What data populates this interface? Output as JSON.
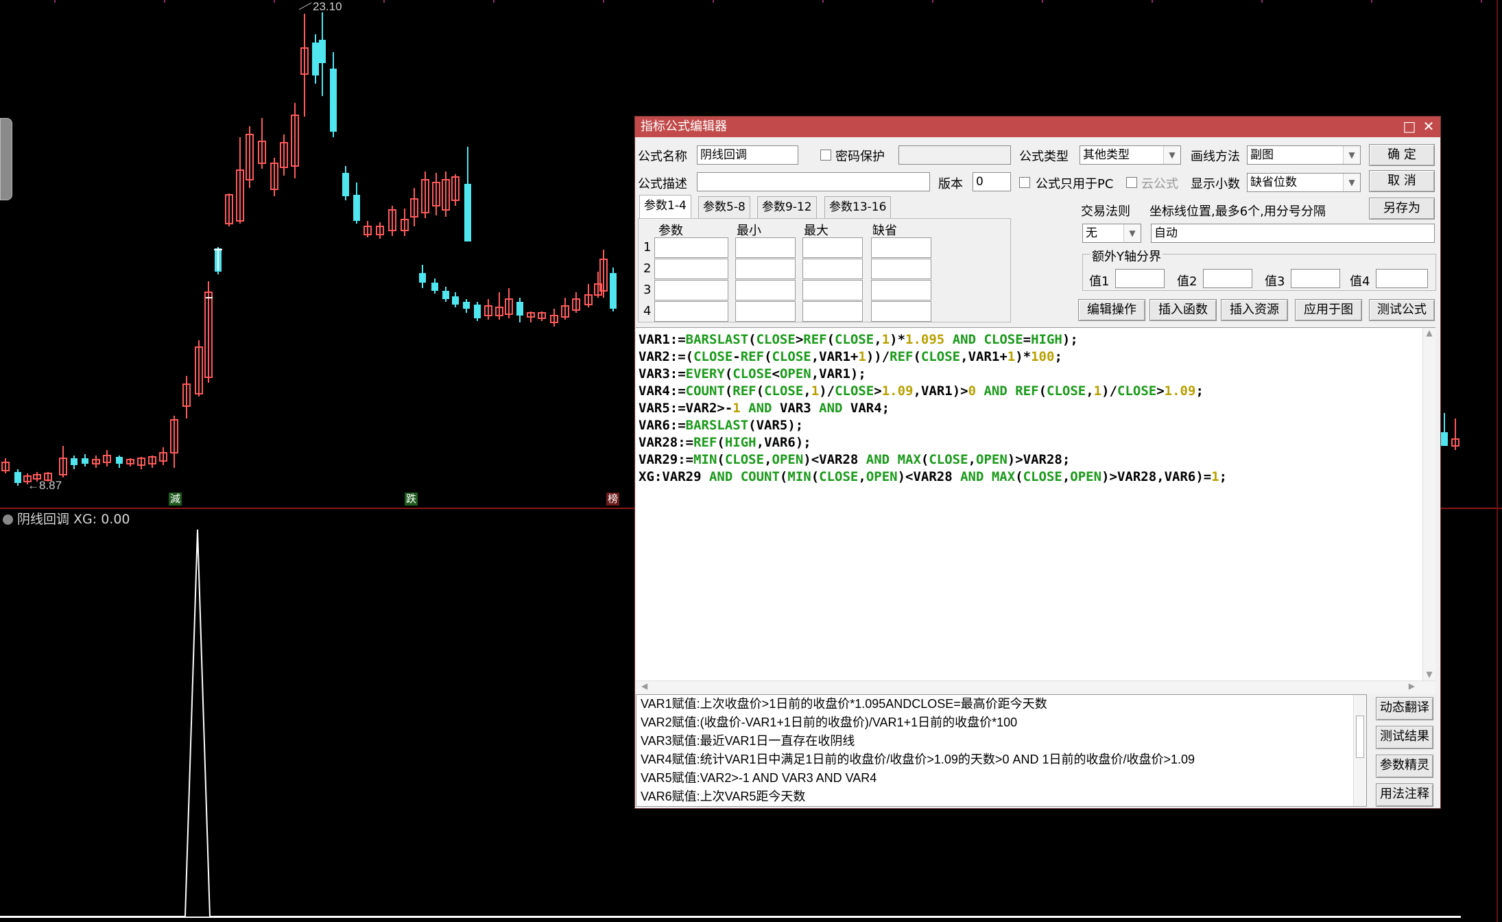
{
  "chart": {
    "high_label": "23.10",
    "low_label": "8.87",
    "markers": [
      "減",
      "跌",
      "榜"
    ]
  },
  "subchart": {
    "title": "阴线回调 XG: 0.00"
  },
  "dialog": {
    "title": "指标公式编辑器",
    "formula_name_label": "公式名称",
    "formula_name_value": "阴线回调",
    "password_label": "密码保护",
    "formula_type_label": "公式类型",
    "formula_type_value": "其他类型",
    "draw_method_label": "画线方法",
    "draw_method_value": "副图",
    "ok_label": "确 定",
    "cancel_label": "取 消",
    "saveas_label": "另存为",
    "desc_label": "公式描述",
    "version_label": "版本",
    "version_value": "0",
    "pc_only_label": "公式只用于PC",
    "cloud_label": "云公式",
    "decimals_label": "显示小数",
    "decimals_value": "缺省位数",
    "tabs": [
      "参数1-4",
      "参数5-8",
      "参数9-12",
      "参数13-16"
    ],
    "param_headers": [
      "参数",
      "最小",
      "最大",
      "缺省"
    ],
    "param_rows": [
      "1",
      "2",
      "3",
      "4"
    ],
    "trade_rule_label": "交易法则",
    "trade_rule_value": "无",
    "coord_label": "坐标线位置,最多6个,用分号分隔",
    "coord_value": "自动",
    "yaxis_group_label": "额外Y轴分界",
    "y_values": [
      "值1",
      "值2",
      "值3",
      "值4"
    ],
    "edit_op_label": "编辑操作",
    "insert_func_label": "插入函数",
    "insert_res_label": "插入资源",
    "apply_label": "应用于图",
    "test_label": "测试公式",
    "side_buttons": [
      "动态翻译",
      "测试结果",
      "参数精灵",
      "用法注释"
    ],
    "translation": [
      "VAR1赋值:上次收盘价>1日前的收盘价*1.095ANDCLOSE=最高价距今天数",
      "VAR2赋值:(收盘价-VAR1+1日前的收盘价)/VAR1+1日前的收盘价*100",
      "VAR3赋值:最近VAR1日一直存在收阴线",
      "VAR4赋值:统计VAR1日中满足1日前的收盘价/收盘价>1.09的天数>0 AND 1日前的收盘价/收盘价>1.09",
      "VAR5赋值:VAR2>-1 AND VAR3 AND VAR4",
      "VAR6赋值:上次VAR5距今天数"
    ]
  },
  "code_lines": [
    [
      [
        "VAR1:=",
        ""
      ],
      [
        "BARSLAST",
        "f"
      ],
      [
        "(",
        ""
      ],
      [
        "CLOSE",
        "f"
      ],
      [
        ">",
        ""
      ],
      [
        "REF",
        "f"
      ],
      [
        "(",
        ""
      ],
      [
        "CLOSE",
        "f"
      ],
      [
        ",",
        ""
      ],
      [
        "1",
        "n"
      ],
      [
        ")*",
        ""
      ],
      [
        "1.095",
        "n"
      ],
      [
        " AND ",
        "f"
      ],
      [
        "CLOSE",
        "f"
      ],
      [
        "=",
        ""
      ],
      [
        "HIGH",
        "f"
      ],
      [
        ");",
        ""
      ]
    ],
    [
      [
        "VAR2:=(",
        ""
      ],
      [
        "CLOSE",
        "f"
      ],
      [
        "-",
        ""
      ],
      [
        "REF",
        "f"
      ],
      [
        "(",
        ""
      ],
      [
        "CLOSE",
        "f"
      ],
      [
        ",VAR1+",
        ""
      ],
      [
        "1",
        "n"
      ],
      [
        "))/",
        ""
      ],
      [
        "REF",
        "f"
      ],
      [
        "(",
        ""
      ],
      [
        "CLOSE",
        "f"
      ],
      [
        ",VAR1+",
        ""
      ],
      [
        "1",
        "n"
      ],
      [
        ")*",
        ""
      ],
      [
        "100",
        "n"
      ],
      [
        ";",
        ""
      ]
    ],
    [
      [
        "VAR3:=",
        ""
      ],
      [
        "EVERY",
        "f"
      ],
      [
        "(",
        ""
      ],
      [
        "CLOSE",
        "f"
      ],
      [
        "<",
        ""
      ],
      [
        "OPEN",
        "f"
      ],
      [
        ",VAR1);",
        ""
      ]
    ],
    [
      [
        "VAR4:=",
        ""
      ],
      [
        "COUNT",
        "f"
      ],
      [
        "(",
        ""
      ],
      [
        "REF",
        "f"
      ],
      [
        "(",
        ""
      ],
      [
        "CLOSE",
        "f"
      ],
      [
        ",",
        ""
      ],
      [
        "1",
        "n"
      ],
      [
        ")/",
        ""
      ],
      [
        "CLOSE",
        "f"
      ],
      [
        ">",
        ""
      ],
      [
        "1.09",
        "n"
      ],
      [
        ",VAR1)>",
        ""
      ],
      [
        "0",
        "n"
      ],
      [
        " AND ",
        "f"
      ],
      [
        "REF",
        "f"
      ],
      [
        "(",
        ""
      ],
      [
        "CLOSE",
        "f"
      ],
      [
        ",",
        ""
      ],
      [
        "1",
        "n"
      ],
      [
        ")/",
        ""
      ],
      [
        "CLOSE",
        "f"
      ],
      [
        ">",
        ""
      ],
      [
        "1.09",
        "n"
      ],
      [
        ";",
        ""
      ]
    ],
    [
      [
        "VAR5:=VAR2>-",
        ""
      ],
      [
        "1",
        "n"
      ],
      [
        " AND ",
        "f"
      ],
      [
        "VAR3",
        ""
      ],
      [
        " AND ",
        "f"
      ],
      [
        "VAR4;",
        ""
      ]
    ],
    [
      [
        "VAR6:=",
        ""
      ],
      [
        "BARSLAST",
        "f"
      ],
      [
        "(VAR5);",
        ""
      ]
    ],
    [
      [
        "VAR28:=",
        ""
      ],
      [
        "REF",
        "f"
      ],
      [
        "(",
        ""
      ],
      [
        "HIGH",
        "f"
      ],
      [
        ",VAR6);",
        ""
      ]
    ],
    [
      [
        "VAR29:=",
        ""
      ],
      [
        "MIN",
        "f"
      ],
      [
        "(",
        ""
      ],
      [
        "CLOSE",
        "f"
      ],
      [
        ",",
        ""
      ],
      [
        "OPEN",
        "f"
      ],
      [
        ")<VAR28",
        ""
      ],
      [
        " AND ",
        "f"
      ],
      [
        "MAX",
        "f"
      ],
      [
        "(",
        ""
      ],
      [
        "CLOSE",
        "f"
      ],
      [
        ",",
        ""
      ],
      [
        "OPEN",
        "f"
      ],
      [
        ")>VAR28;",
        ""
      ]
    ],
    [
      [
        "XG:VAR29",
        ""
      ],
      [
        " AND ",
        "f"
      ],
      [
        "COUNT",
        "f"
      ],
      [
        "(",
        ""
      ],
      [
        "MIN",
        "f"
      ],
      [
        "(",
        ""
      ],
      [
        "CLOSE",
        "f"
      ],
      [
        ",",
        ""
      ],
      [
        "OPEN",
        "f"
      ],
      [
        ")<VAR28",
        ""
      ],
      [
        " AND ",
        "f"
      ],
      [
        "MAX",
        "f"
      ],
      [
        "(",
        ""
      ],
      [
        "CLOSE",
        "f"
      ],
      [
        ",",
        ""
      ],
      [
        "OPEN",
        "f"
      ],
      [
        ")>VAR28,VAR6)=",
        ""
      ],
      [
        "1",
        "n"
      ],
      [
        ";",
        ""
      ]
    ]
  ]
}
